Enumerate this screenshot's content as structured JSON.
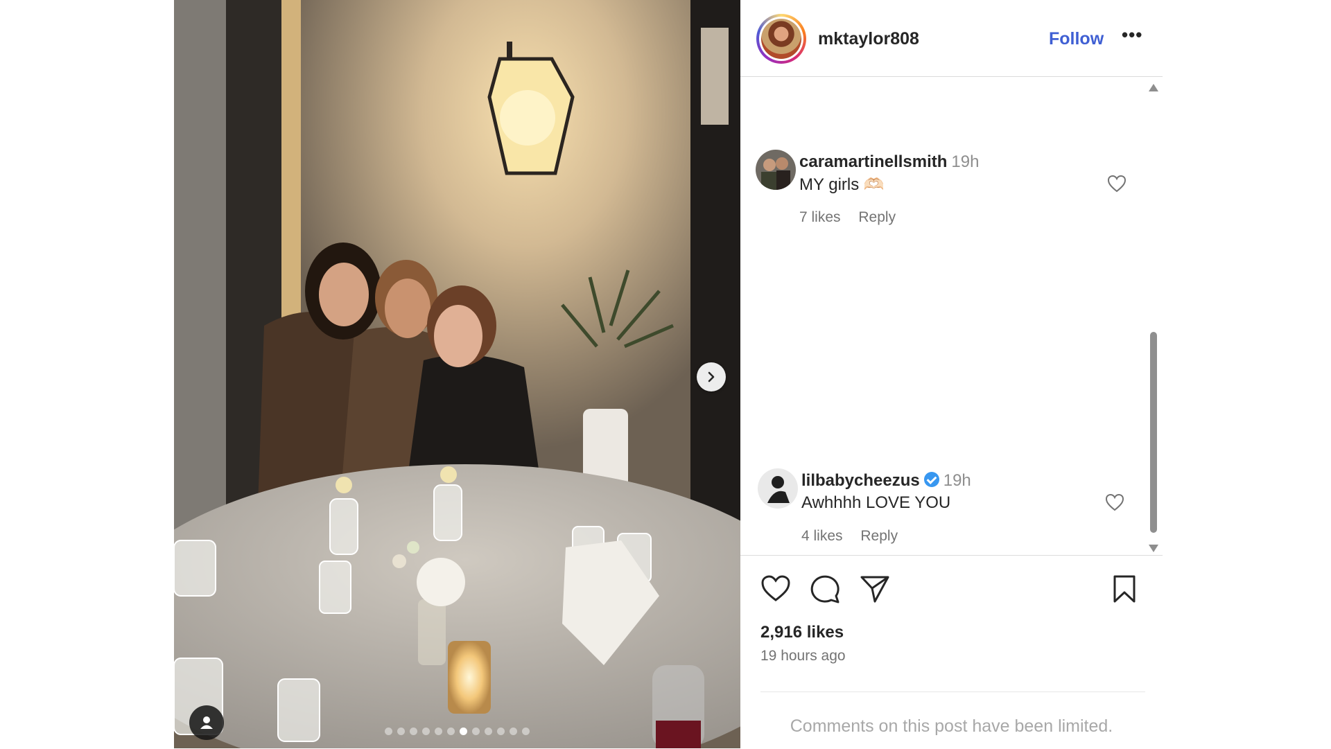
{
  "post": {
    "author": "mktaylor808",
    "follow_label": "Follow",
    "more_label": "•••",
    "carousel": {
      "total": 12,
      "current": 7
    }
  },
  "comments": [
    {
      "user": "caramartinellsmith",
      "time": "19h",
      "text": "MY girls 🫶🏻",
      "likes": "7 likes",
      "reply": "Reply",
      "verified": false
    },
    {
      "user": "lilbabycheezus",
      "time": "19h",
      "text": "Awhhhh LOVE YOU",
      "likes": "4 likes",
      "reply": "Reply",
      "verified": true
    }
  ],
  "stats": {
    "likes": "2,916 likes",
    "time_ago": "19 hours ago"
  },
  "footer": {
    "limited_notice": "Comments on this post have been limited."
  },
  "icons": {
    "like": "heart-icon",
    "comment": "comment-icon",
    "share": "share-icon",
    "save": "bookmark-icon",
    "next": "chevron-right-icon",
    "tags": "user-tag-icon"
  },
  "colors": {
    "follow": "#3f5fd3",
    "verified": "#3897f0",
    "secondary_text": "#737373"
  }
}
